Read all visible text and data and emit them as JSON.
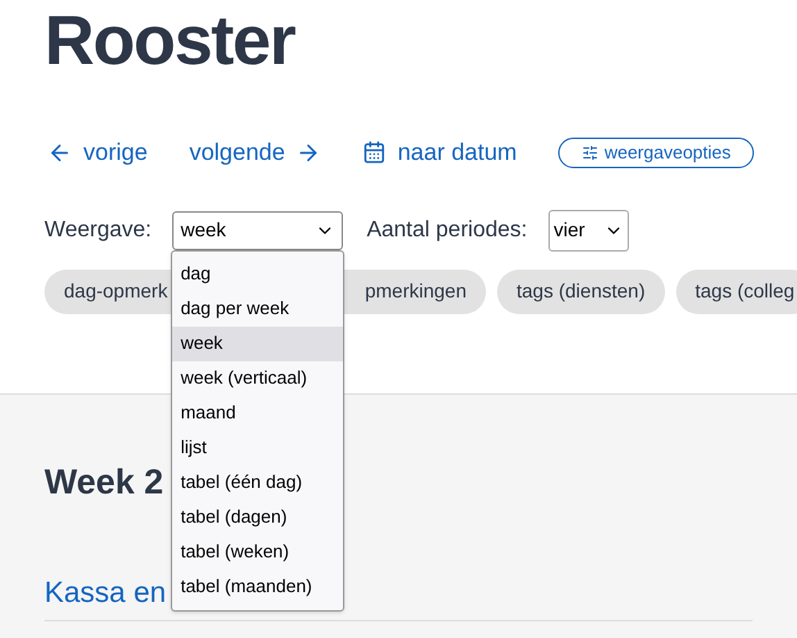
{
  "title": "Rooster",
  "nav": [
    {
      "label": "vorige",
      "kind": "prev"
    },
    {
      "label": "volgende",
      "kind": "next"
    },
    {
      "label": "naar datum",
      "kind": "date"
    },
    {
      "label": "weergaveopties",
      "kind": "options"
    }
  ],
  "view": {
    "label": "Weergave:",
    "value": "week",
    "expanded": true,
    "options": [
      {
        "label": "dag",
        "selected": false
      },
      {
        "label": "dag per week",
        "selected": false
      },
      {
        "label": "week",
        "selected": true
      },
      {
        "label": "week (verticaal)",
        "selected": false
      },
      {
        "label": "maand",
        "selected": false
      },
      {
        "label": "lijst",
        "selected": false
      },
      {
        "label": "tabel (één dag)",
        "selected": false
      },
      {
        "label": "tabel (dagen)",
        "selected": false
      },
      {
        "label": "tabel (weken)",
        "selected": false
      },
      {
        "label": "tabel (maanden)",
        "selected": false
      }
    ]
  },
  "periods": {
    "label": "Aantal periodes:",
    "value": "vier"
  },
  "chips": [
    "dag-opmerk",
    "pmerkingen",
    "tags (diensten)",
    "tags (colleg"
  ],
  "week_heading": "Week 2",
  "section_link": "Kassa en"
}
